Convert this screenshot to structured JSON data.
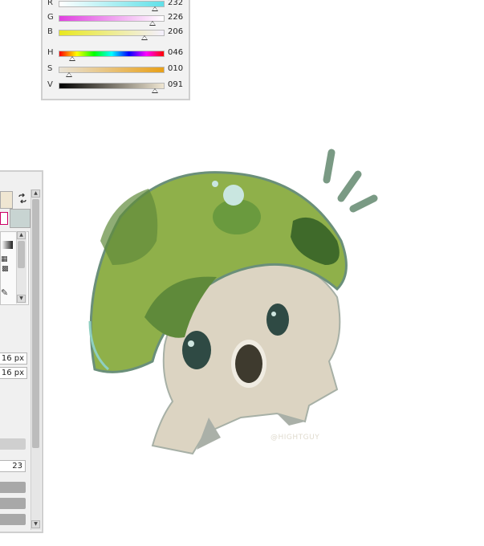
{
  "color_panel": {
    "sliders": [
      {
        "label": "R",
        "value": "232",
        "level": 0.91,
        "gradient": "linear-gradient(90deg,#ffffff,#60e0e8)"
      },
      {
        "label": "G",
        "value": "226",
        "level": 0.89,
        "gradient": "linear-gradient(90deg,#e040e0,#ffffff)"
      },
      {
        "label": "B",
        "value": "206",
        "level": 0.81,
        "gradient": "linear-gradient(90deg,#e8e820,#f4f0ff)"
      },
      {
        "label": "H",
        "value": "046",
        "level": 0.13,
        "gradient": "linear-gradient(90deg,#ff0000,#ffff00,#00ff00,#00ffff,#0000ff,#ff00ff,#ff0000)"
      },
      {
        "label": "S",
        "value": "010",
        "level": 0.1,
        "gradient": "linear-gradient(90deg,#e8e2d6,#e8a018)"
      },
      {
        "label": "V",
        "value": "091",
        "level": 0.91,
        "gradient": "linear-gradient(90deg,#000000,#efe6d2)"
      }
    ]
  },
  "tool_panel": {
    "primary_color": "#efe6d2",
    "secondary_color": "#c8d4d2",
    "brush_width": "16 px",
    "brush_height": "16 px",
    "opacity_value": "23"
  },
  "canvas": {
    "signature": "@HIGHTGUY",
    "cap_color": "#8fb04a",
    "body_color": "#dcd4c2"
  }
}
